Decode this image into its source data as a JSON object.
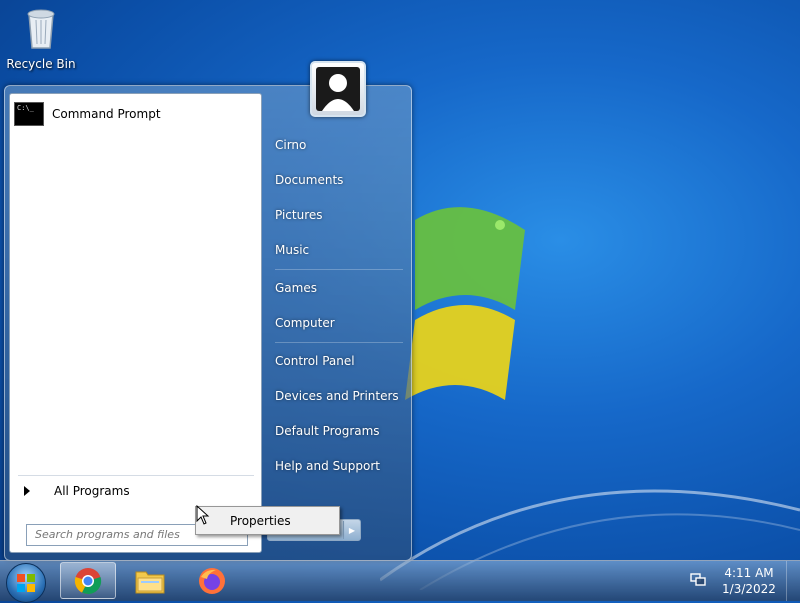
{
  "desktop": {
    "recycle_bin_label": "Recycle Bin"
  },
  "start_menu": {
    "pinned": [
      {
        "label": "Command Prompt",
        "icon": "command-prompt-icon",
        "icon_text": "C:\\_"
      }
    ],
    "all_programs_label": "All Programs",
    "search_placeholder": "Search programs and files",
    "user_name": "Cirno",
    "right_items": [
      {
        "label": "Cirno"
      },
      {
        "label": "Documents"
      },
      {
        "label": "Pictures"
      },
      {
        "label": "Music"
      },
      {
        "label": "Games"
      },
      {
        "label": "Computer"
      },
      {
        "label": "Control Panel"
      },
      {
        "label": "Devices and Printers"
      },
      {
        "label": "Default Programs"
      },
      {
        "label": "Help and Support"
      }
    ]
  },
  "context_menu": {
    "items": [
      {
        "label": "Properties"
      }
    ]
  },
  "taskbar": {
    "apps": [
      {
        "name": "chrome-icon",
        "active": true
      },
      {
        "name": "file-explorer-icon",
        "active": false
      },
      {
        "name": "firefox-icon",
        "active": false
      }
    ],
    "clock_time": "4:11 AM",
    "clock_date": "1/3/2022"
  },
  "colors": {
    "desktop_blue": "#1668c9",
    "taskbar": "#2b4a73",
    "menu_text": "#ffffff"
  }
}
